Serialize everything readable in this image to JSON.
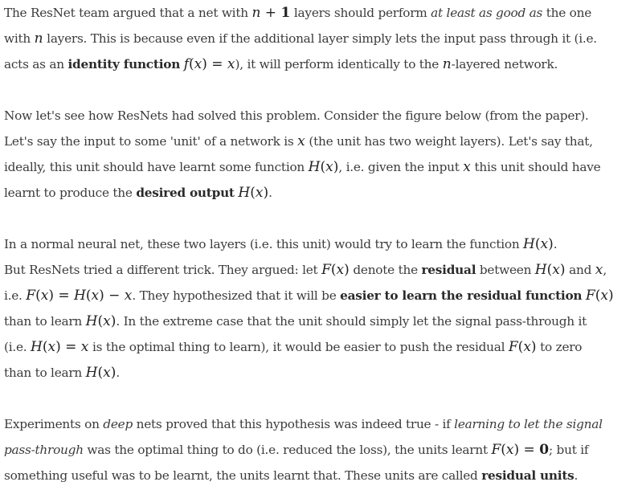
{
  "paragraphs": [
    {
      "lines": [
        [
          {
            "t": "The ResNet team argued that a net with "
          },
          {
            "t": "n",
            "m": true
          },
          {
            "t": " + ",
            "mn": true
          },
          {
            "t": "1",
            "mn": true,
            "b": true
          },
          {
            "t": "  layers should perform "
          },
          {
            "t": "at least as good as",
            "em": true
          },
          {
            "t": " the one"
          }
        ],
        [
          {
            "t": "with "
          },
          {
            "t": "n",
            "m": true
          },
          {
            "t": " layers. This is because even if the additional layer simply lets the input pass through it (i.e."
          }
        ],
        [
          {
            "t": "acts as an "
          },
          {
            "t": "identity function",
            "strong": true
          },
          {
            "t": " "
          },
          {
            "t": "f",
            "m": true
          },
          {
            "t": "(",
            "mn": true
          },
          {
            "t": "x",
            "m": true
          },
          {
            "t": ") = ",
            "mn": true
          },
          {
            "t": "x",
            "m": true
          },
          {
            "t": "), it will perform identically to the "
          },
          {
            "t": "n",
            "m": true
          },
          {
            "t": "-layered network."
          }
        ]
      ]
    },
    {
      "lines": [
        [
          {
            "t": "Now let's see how ResNets had solved this problem. Consider the figure below (from the paper)."
          }
        ],
        [
          {
            "t": "Let's say the input to some 'unit' of a network is "
          },
          {
            "t": "x",
            "m": true
          },
          {
            "t": " (the unit has two weight layers). Let's say that,"
          }
        ],
        [
          {
            "t": "ideally, this unit should have learnt some function "
          },
          {
            "t": "H",
            "m": true
          },
          {
            "t": "(",
            "mn": true
          },
          {
            "t": "x",
            "m": true
          },
          {
            "t": ")",
            "mn": true
          },
          {
            "t": ", i.e. given the input "
          },
          {
            "t": "x",
            "m": true
          },
          {
            "t": " this unit should have"
          }
        ],
        [
          {
            "t": "learnt to produce the "
          },
          {
            "t": "desired output",
            "strong": true
          },
          {
            "t": " "
          },
          {
            "t": "H",
            "m": true
          },
          {
            "t": "(",
            "mn": true
          },
          {
            "t": "x",
            "m": true
          },
          {
            "t": ")",
            "mn": true
          },
          {
            "t": "."
          }
        ]
      ]
    },
    {
      "lines": [
        [
          {
            "t": "In a normal neural net, these two layers (i.e. this unit) would try to learn the function "
          },
          {
            "t": "H",
            "m": true
          },
          {
            "t": "(",
            "mn": true
          },
          {
            "t": "x",
            "m": true
          },
          {
            "t": ")",
            "mn": true
          },
          {
            "t": "."
          }
        ],
        [
          {
            "t": "But ResNets tried a different trick. They argued: let "
          },
          {
            "t": "F",
            "m": true
          },
          {
            "t": "(",
            "mn": true
          },
          {
            "t": "x",
            "m": true
          },
          {
            "t": ")",
            "mn": true
          },
          {
            "t": " denote the "
          },
          {
            "t": "residual",
            "strong": true
          },
          {
            "t": " between "
          },
          {
            "t": "H",
            "m": true
          },
          {
            "t": "(",
            "mn": true
          },
          {
            "t": "x",
            "m": true
          },
          {
            "t": ")",
            "mn": true
          },
          {
            "t": " and "
          },
          {
            "t": "x",
            "m": true
          },
          {
            "t": ","
          }
        ],
        [
          {
            "t": "i.e. "
          },
          {
            "t": "F",
            "m": true
          },
          {
            "t": "(",
            "mn": true
          },
          {
            "t": "x",
            "m": true
          },
          {
            "t": ") = ",
            "mn": true
          },
          {
            "t": "H",
            "m": true
          },
          {
            "t": "(",
            "mn": true
          },
          {
            "t": "x",
            "m": true
          },
          {
            "t": ") − ",
            "mn": true
          },
          {
            "t": "x",
            "m": true
          },
          {
            "t": ". They hypothesized that it will be "
          },
          {
            "t": "easier to learn the residual function",
            "strong": true
          },
          {
            "t": " "
          },
          {
            "t": "F",
            "m": true
          },
          {
            "t": "(",
            "mn": true
          },
          {
            "t": "x",
            "m": true
          },
          {
            "t": ")",
            "mn": true
          }
        ],
        [
          {
            "t": " than to learn "
          },
          {
            "t": "H",
            "m": true
          },
          {
            "t": "(",
            "mn": true
          },
          {
            "t": "x",
            "m": true
          },
          {
            "t": ")",
            "mn": true
          },
          {
            "t": ". In the extreme case that the unit should simply let the signal pass-through it"
          }
        ],
        [
          {
            "t": "(i.e. "
          },
          {
            "t": "H",
            "m": true
          },
          {
            "t": "(",
            "mn": true
          },
          {
            "t": "x",
            "m": true
          },
          {
            "t": ") = ",
            "mn": true
          },
          {
            "t": "x",
            "m": true
          },
          {
            "t": " is the optimal thing to learn), it would be easier to push the residual "
          },
          {
            "t": "F",
            "m": true
          },
          {
            "t": "(",
            "mn": true
          },
          {
            "t": "x",
            "m": true
          },
          {
            "t": ")",
            "mn": true
          },
          {
            "t": " to zero"
          }
        ],
        [
          {
            "t": "than to learn "
          },
          {
            "t": "H",
            "m": true
          },
          {
            "t": "(",
            "mn": true
          },
          {
            "t": "x",
            "m": true
          },
          {
            "t": ")",
            "mn": true
          },
          {
            "t": "."
          }
        ]
      ]
    },
    {
      "lines": [
        [
          {
            "t": "Experiments on "
          },
          {
            "t": "deep",
            "em": true
          },
          {
            "t": " nets proved that this hypothesis was indeed true - if "
          },
          {
            "t": "learning to let the signal",
            "em": true
          }
        ],
        [
          {
            "t": "pass-through",
            "em": true
          },
          {
            "t": " was the optimal thing to do (i.e. reduced the loss), the units learnt "
          },
          {
            "t": "F",
            "m": true
          },
          {
            "t": "(",
            "mn": true
          },
          {
            "t": "x",
            "m": true
          },
          {
            "t": ") = ",
            "mn": true
          },
          {
            "t": "0",
            "mn": true,
            "b": true
          },
          {
            "t": "; but if"
          }
        ],
        [
          {
            "t": "something useful was to be learnt, the units learnt that. These units are called "
          },
          {
            "t": "residual units",
            "strong": true
          },
          {
            "t": "."
          }
        ]
      ]
    }
  ]
}
